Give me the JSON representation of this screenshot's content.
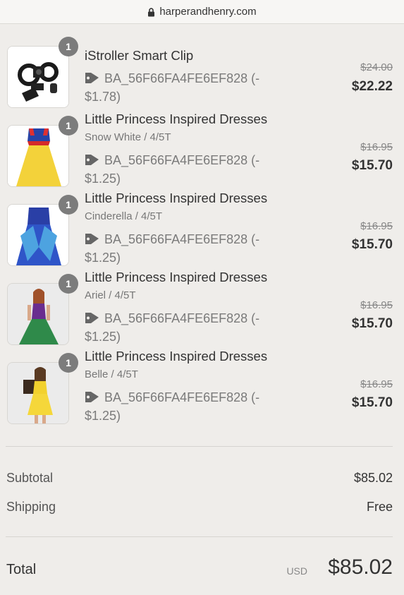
{
  "browser": {
    "url": "harperandhenry.com"
  },
  "items": [
    {
      "quantity": "1",
      "title": "iStroller Smart Clip",
      "variant": "",
      "discount_line1": "BA_56F66FA4FE6EF828 (-",
      "discount_line2": "$1.78)",
      "original_price": "$24.00",
      "price": "$22.22",
      "thumb_icon": "stroller-clip-image"
    },
    {
      "quantity": "1",
      "title": "Little Princess Inspired Dresses",
      "variant": "Snow White / 4/5T",
      "discount_line1": "BA_56F66FA4FE6EF828 (-",
      "discount_line2": "$1.25)",
      "original_price": "$16.95",
      "price": "$15.70",
      "thumb_icon": "snow-white-dress-image"
    },
    {
      "quantity": "1",
      "title": "Little Princess Inspired Dresses",
      "variant": "Cinderella / 4/5T",
      "discount_line1": "BA_56F66FA4FE6EF828 (-",
      "discount_line2": "$1.25)",
      "original_price": "$16.95",
      "price": "$15.70",
      "thumb_icon": "cinderella-dress-image"
    },
    {
      "quantity": "1",
      "title": "Little Princess Inspired Dresses",
      "variant": "Ariel / 4/5T",
      "discount_line1": "BA_56F66FA4FE6EF828 (-",
      "discount_line2": "$1.25)",
      "original_price": "$16.95",
      "price": "$15.70",
      "thumb_icon": "ariel-dress-image"
    },
    {
      "quantity": "1",
      "title": "Little Princess Inspired Dresses",
      "variant": "Belle / 4/5T",
      "discount_line1": "BA_56F66FA4FE6EF828 (-",
      "discount_line2": "$1.25)",
      "original_price": "$16.95",
      "price": "$15.70",
      "thumb_icon": "belle-dress-image"
    }
  ],
  "summary": {
    "subtotal_label": "Subtotal",
    "subtotal_value": "$85.02",
    "shipping_label": "Shipping",
    "shipping_value": "Free",
    "total_label": "Total",
    "currency": "USD",
    "total_value": "$85.02"
  },
  "colors": {
    "background": "#efedea",
    "badge": "#7c7c7c",
    "text": "#333333"
  }
}
